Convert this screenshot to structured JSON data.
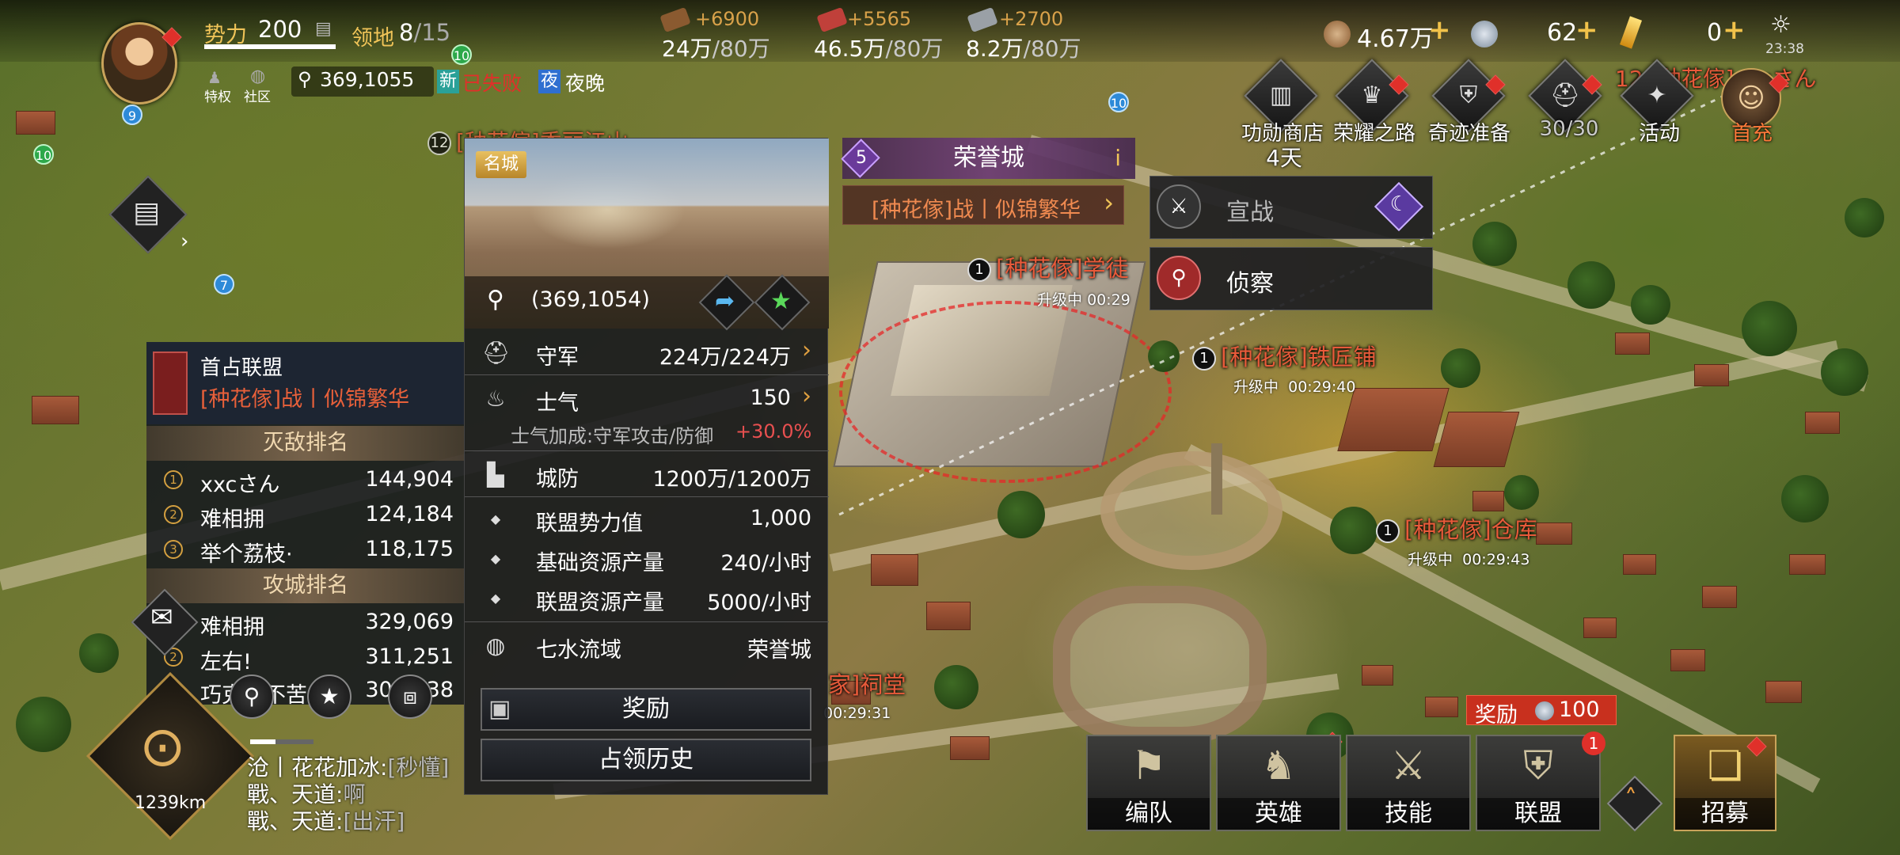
{
  "topbar": {
    "power_label": "势力",
    "power_value": "200",
    "territory_label": "领地",
    "territory_value": "8",
    "territory_cap": "/15",
    "privilege_label": "特权",
    "community_label": "社区",
    "coords": "369,1055",
    "tag_new": "新",
    "tag_lost": "已失败",
    "tag_night": "夜",
    "night_text": "夜晚",
    "avatar_level": "9",
    "resources": [
      {
        "gain": "+6900",
        "amount": "24万",
        "cap": "/80万",
        "color": "#8a5a30"
      },
      {
        "gain": "+5565",
        "amount": "46.5万",
        "cap": "/80万",
        "color": "#c0403a"
      },
      {
        "gain": "+2700",
        "amount": "8.2万",
        "cap": "/80万",
        "color": "#9aa0a6"
      }
    ],
    "copper": "4.67万",
    "silver": "62",
    "gold": "0",
    "time": "23:38"
  },
  "top_icons": [
    {
      "label": "功勋商店",
      "sub": "4天",
      "icon": "shop-icon",
      "glyph": "▥"
    },
    {
      "label": "荣耀之路",
      "icon": "crown-icon",
      "glyph": "♛"
    },
    {
      "label": "奇迹准备",
      "icon": "shield-icon",
      "glyph": "⛨"
    },
    {
      "label": "30/30",
      "icon": "helmet-icon",
      "glyph": "⛑"
    },
    {
      "label": "活动",
      "icon": "event-icon",
      "glyph": "✦"
    },
    {
      "label": "首充",
      "icon": "first-charge-icon",
      "glyph": "☺"
    }
  ],
  "top_right_player": "12 [种花傢]xxcさん",
  "side_levels": [
    "10",
    "10",
    "10",
    "7"
  ],
  "left_panel": {
    "alliance_title": "首占联盟",
    "alliance_name": "[种花傢]战丨似锦繁华",
    "kill_rank_title": "灭敌排名",
    "kill_rank": [
      {
        "rank": "1",
        "name": "xxcさん",
        "score": "144,904"
      },
      {
        "rank": "2",
        "name": "难相拥",
        "score": "124,184"
      },
      {
        "rank": "3",
        "name": "举个荔枝·",
        "score": "118,175"
      }
    ],
    "siege_rank_title": "攻城排名",
    "siege_rank": [
      {
        "rank": "1",
        "name": "难相拥",
        "score": "329,069"
      },
      {
        "rank": "2",
        "name": "左右!",
        "score": "311,251"
      },
      {
        "rank": "3",
        "name": "巧克力不苦",
        "score": "300,038"
      }
    ]
  },
  "info_panel": {
    "badge": "名城",
    "coords": "(369,1054)",
    "rows": [
      {
        "icon": "helmet-icon",
        "glyph": "⛑",
        "label": "守军",
        "value": "224万/224万",
        "arrow": true
      },
      {
        "icon": "flame-icon",
        "glyph": "♨",
        "label": "士气",
        "value": "150",
        "arrow": true
      }
    ],
    "morale_bonus_label": "士气加成:守军攻击/防御",
    "morale_bonus_value": "+30.0%",
    "defense": {
      "icon": "wall-icon",
      "glyph": "▙",
      "label": "城防",
      "value": "1200万/1200万"
    },
    "stats": [
      {
        "label": "联盟势力值",
        "value": "1,000"
      },
      {
        "label": "基础资源产量",
        "value": "240/小时"
      },
      {
        "label": "联盟资源产量",
        "value": "5000/小时"
      }
    ],
    "region": {
      "icon": "globe-icon",
      "glyph": "◍",
      "label": "七水流域",
      "value": "荣誉城"
    },
    "reward_button": "奖励",
    "history_button": "占领历史"
  },
  "popup": {
    "level": "5",
    "title": "荣誉城",
    "owner": "[种花傢]战丨似锦繁华",
    "declare_war": "宣战",
    "scout": "侦察"
  },
  "map_labels": [
    {
      "num": "1",
      "name": "[种花傢]学徒",
      "status": "升级中",
      "timer": "00:29"
    },
    {
      "num": "1",
      "name": "[种花傢]铁匠铺",
      "status": "升级中",
      "timer": "00:29:40"
    },
    {
      "num": "1",
      "name": "[种花傢]仓库",
      "status": "升级中",
      "timer": "00:29:43"
    },
    {
      "num": "",
      "name": "家]祠堂",
      "status": "",
      "timer": "00:29:31"
    },
    {
      "num": "12",
      "name": "[种花傢]秀丽江山",
      "status": "",
      "timer": ""
    }
  ],
  "chat": [
    {
      "prefix": "沧丨花花加冰:",
      "msg": "[秒懂]"
    },
    {
      "prefix": "戰、天道:",
      "msg": "啊"
    },
    {
      "prefix": "戰、天道:",
      "msg": "[出汗]"
    }
  ],
  "compass_distance": "1239km",
  "reward_chip": {
    "label": "奖励",
    "value": "100"
  },
  "bottom_buttons": [
    {
      "label": "编队",
      "icon": "flag-icon",
      "glyph": "⚑"
    },
    {
      "label": "英雄",
      "icon": "knight-icon",
      "glyph": "♞"
    },
    {
      "label": "技能",
      "icon": "swords-icon",
      "glyph": "⚔"
    },
    {
      "label": "联盟",
      "icon": "alliance-icon",
      "glyph": "⛨"
    },
    {
      "label": "招募",
      "icon": "book-icon",
      "glyph": "❏"
    }
  ],
  "alliance_badge": "1"
}
